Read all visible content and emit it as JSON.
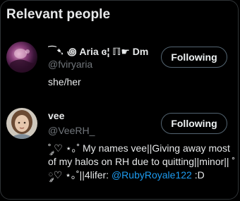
{
  "section": {
    "title": "Relevant people"
  },
  "people": [
    {
      "name": "⁀➷ ꩜ Aria ɞ¦ ℿ☛ Dm",
      "handle": "@fviryaria",
      "bio_text": "she/her",
      "bio_mention": "",
      "bio_after": "",
      "follow_label": "Following",
      "avatar_icon": "avatar-photo-purple"
    },
    {
      "name": "vee",
      "handle": "@VeeRH_",
      "bio_text": "˚ ༘♡ ⋆｡˚ My names vee||Giving away most of my halos on RH due to quitting||minor|| ˚ ༘♡ ⋆｡˚||4lifer: ",
      "bio_mention": "@RubyRoyale122",
      "bio_after": " :D",
      "follow_label": "Following",
      "avatar_icon": "avatar-photo-girl"
    }
  ],
  "colors": {
    "background": "#000000",
    "text_primary": "#e7e9ea",
    "text_secondary": "#71767b",
    "link": "#1d9bf0",
    "border": "#2f3336"
  }
}
